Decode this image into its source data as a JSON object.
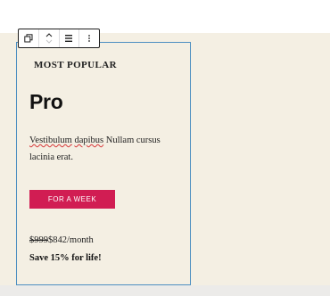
{
  "block_toolbar": {
    "buttons": [
      {
        "icon": "duplicate-icon"
      },
      {
        "icon": "move-up-down-icon"
      },
      {
        "icon": "align-icon"
      },
      {
        "icon": "more-options-icon"
      }
    ]
  },
  "pricing_card": {
    "eyebrow": "MOST POPULAR",
    "plan_name": "Pro",
    "description_word1": "Vestibulum",
    "description_word2": "dapibus",
    "description_rest": " Nullam cursus lacinia erat.",
    "cta_label": "FOR A WEEK",
    "cta_color": "#d11d53",
    "price_old": "$999",
    "price_new": "$842/month",
    "savings": "Save 15% for life!"
  },
  "colors": {
    "background": "#f4efe3",
    "selection_border": "#4d8fc1"
  }
}
